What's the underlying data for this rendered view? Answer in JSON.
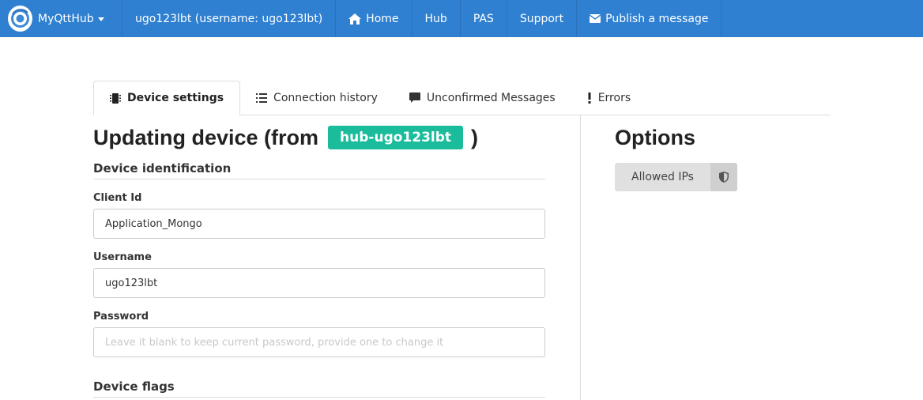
{
  "navbar": {
    "brand": "MyQttHub",
    "user": "ugo123lbt (username: ugo123lbt)",
    "home": "Home",
    "hub": "Hub",
    "pas": "PAS",
    "support": "Support",
    "publish": "Publish a message",
    "color": "#2f80d1"
  },
  "tabs": [
    {
      "label": "Device settings",
      "icon": "chip-icon",
      "active": true
    },
    {
      "label": "Connection history",
      "icon": "list-icon",
      "active": false
    },
    {
      "label": "Unconfirmed Messages",
      "icon": "comment-icon",
      "active": false
    },
    {
      "label": "Errors",
      "icon": "exclamation-icon",
      "active": false
    }
  ],
  "main": {
    "title_prefix": "Updating device (from",
    "hub_badge": "hub-ugo123lbt",
    "title_suffix": ")",
    "badge_color": "#1abc9c",
    "section_identification": "Device identification",
    "client_id_label": "Client Id",
    "client_id_value": "Application_Mongo",
    "username_label": "Username",
    "username_value": "ugo123lbt",
    "password_label": "Password",
    "password_placeholder": "Leave it blank to keep current password, provide one to change it",
    "section_flags": "Device flags"
  },
  "options": {
    "title": "Options",
    "allowed_ips": "Allowed IPs",
    "shield_icon": "shield-icon"
  }
}
